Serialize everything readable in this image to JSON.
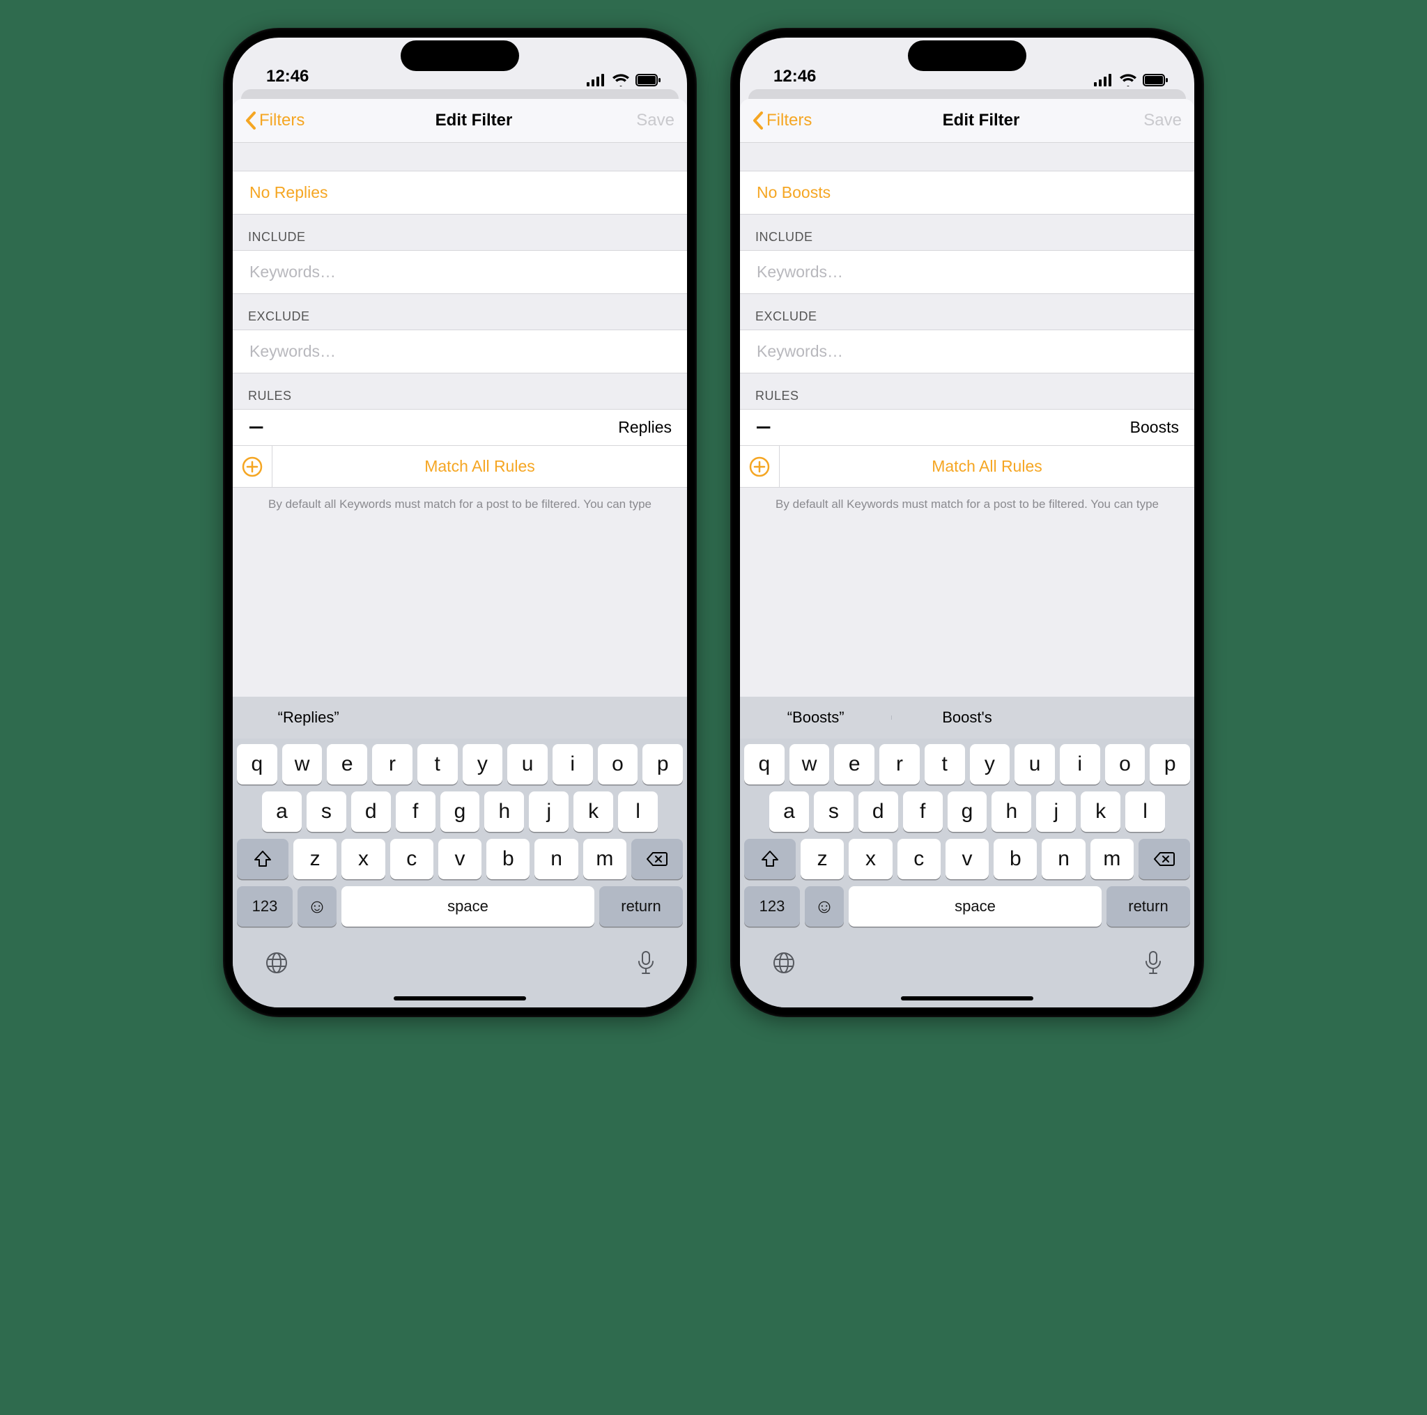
{
  "status": {
    "time": "12:46"
  },
  "nav": {
    "back_label": "Filters",
    "title": "Edit Filter",
    "save_label": "Save"
  },
  "sections": {
    "include_header": "INCLUDE",
    "exclude_header": "EXCLUDE",
    "rules_header": "RULES",
    "keywords_placeholder": "Keywords…",
    "match_all_label": "Match All Rules",
    "footer_text": "By default all Keywords must match for a post to be filtered. You can type"
  },
  "keyboard": {
    "row1": [
      "q",
      "w",
      "e",
      "r",
      "t",
      "y",
      "u",
      "i",
      "o",
      "p"
    ],
    "row2": [
      "a",
      "s",
      "d",
      "f",
      "g",
      "h",
      "j",
      "k",
      "l"
    ],
    "row3": [
      "z",
      "x",
      "c",
      "v",
      "b",
      "n",
      "m"
    ],
    "numbers_label": "123",
    "space_label": "space",
    "return_label": "return"
  },
  "phones": [
    {
      "name_value": "No Replies",
      "rule_label": "Replies",
      "suggestions": [
        "“Replies”",
        "",
        ""
      ]
    },
    {
      "name_value": "No Boosts",
      "rule_label": "Boosts",
      "suggestions": [
        "“Boosts”",
        "Boost's",
        ""
      ]
    }
  ]
}
